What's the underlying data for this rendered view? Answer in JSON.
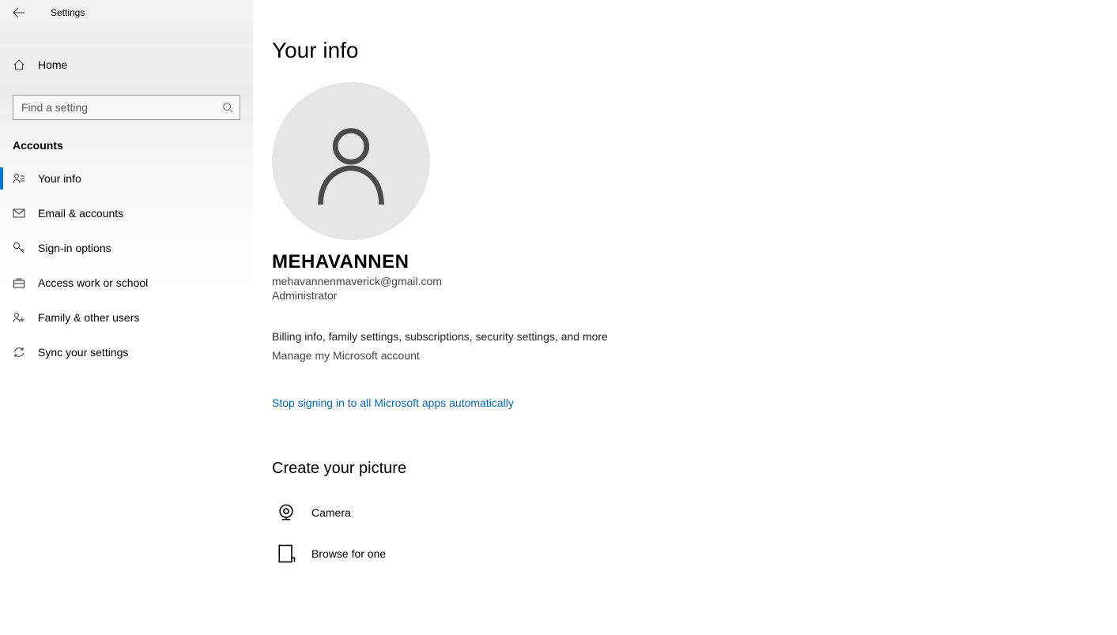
{
  "header": {
    "app_title": "Settings"
  },
  "sidebar": {
    "home_label": "Home",
    "search_placeholder": "Find a setting",
    "section_header": "Accounts",
    "items": [
      {
        "label": "Your info"
      },
      {
        "label": "Email & accounts"
      },
      {
        "label": "Sign-in options"
      },
      {
        "label": "Access work or school"
      },
      {
        "label": "Family & other users"
      },
      {
        "label": "Sync your settings"
      }
    ]
  },
  "main": {
    "page_title": "Your info",
    "user_name": "MEHAVANNEN",
    "user_email": "mehavannenmaverick@gmail.com",
    "user_role": "Administrator",
    "billing_line": "Billing info, family settings, subscriptions, security settings, and more",
    "manage_link": "Manage my Microsoft account",
    "stop_link": "Stop signing in to all Microsoft apps automatically",
    "create_picture_heading": "Create your picture",
    "picture_options": [
      {
        "label": "Camera"
      },
      {
        "label": "Browse for one"
      }
    ]
  }
}
